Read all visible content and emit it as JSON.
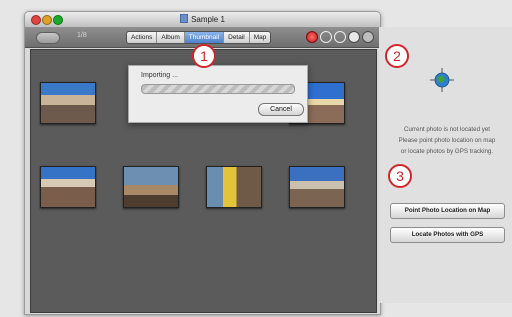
{
  "window": {
    "title": "Sample 1"
  },
  "toolbar": {
    "photo_count": "1/8",
    "tabs": [
      {
        "label": "Actions"
      },
      {
        "label": "Album"
      },
      {
        "label": "Thumbnail",
        "active": true
      },
      {
        "label": "Detail"
      },
      {
        "label": "Map"
      }
    ],
    "icons": [
      "record-icon",
      "refresh-icon",
      "sync-icon",
      "compass-icon",
      "close-icon"
    ]
  },
  "dialog": {
    "title": "Importing ...",
    "cancel_label": "Cancel"
  },
  "side_panel": {
    "info_lines": [
      "Current photo is not located yet",
      "Please point photo location on map",
      "or locate photos by GPS tracking."
    ],
    "point_button_label": "Point Photo Location on Map",
    "gps_button_label": "Locate Photos with GPS"
  },
  "callouts": [
    "1",
    "2",
    "3"
  ],
  "colors": {
    "callout": "#d4242a",
    "active_tab": "#4d81c9",
    "content_bg": "#5b5b5b"
  }
}
